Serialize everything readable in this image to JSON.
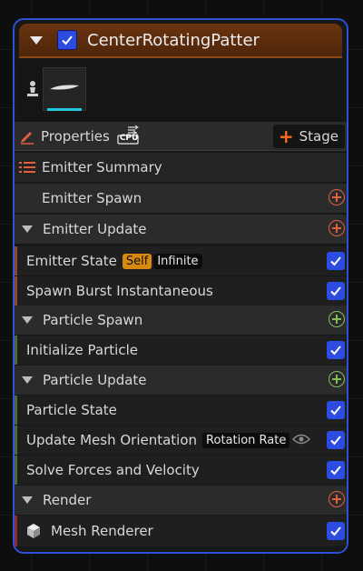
{
  "emitter": {
    "title": "CenterRotatingPatter",
    "enabled": true
  },
  "toolbar": {
    "properties_label": "Properties",
    "cpu_label": "CPU",
    "stage_label": "Stage"
  },
  "summary_label": "Emitter Summary",
  "emitter_spawn_label": "Emitter Spawn",
  "emitter_update": {
    "label": "Emitter Update",
    "emitter_state_label": "Emitter State",
    "self_chip": "Self",
    "infinite_chip": "Infinite",
    "spawn_burst_label": "Spawn Burst Instantaneous"
  },
  "particle_spawn": {
    "label": "Particle Spawn",
    "initialize_label": "Initialize Particle"
  },
  "particle_update": {
    "label": "Particle Update",
    "particle_state_label": "Particle State",
    "update_mesh_label": "Update Mesh Orientation",
    "rotation_chip": "Rotation Rate",
    "solve_forces_label": "Solve Forces and Velocity"
  },
  "render": {
    "label": "Render",
    "mesh_renderer_label": "Mesh Renderer"
  },
  "colors": {
    "accent": "#2c4be0",
    "header": "#5a2c0c",
    "add_orange": "#e06040",
    "add_green": "#7fbf5a",
    "stage_plus": "#ff6a18"
  },
  "icons": [
    "collapse-arrow-icon",
    "checkbox-icon",
    "pin-icon",
    "pencil-icon",
    "cpu-icon",
    "plus-icon",
    "list-icon",
    "add-circle-icon",
    "eye-icon",
    "cube-icon"
  ]
}
